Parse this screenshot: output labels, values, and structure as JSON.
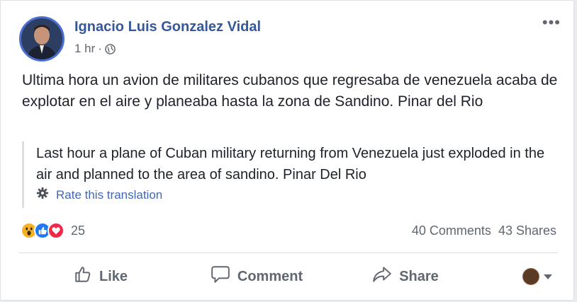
{
  "post": {
    "author": "Ignacio Luis Gonzalez Vidal",
    "time": "1 hr",
    "separator": "·",
    "privacy_icon": "globe-icon",
    "more_icon": "•••",
    "text": "Ultima hora un avion de militares cubanos que regresaba de venezuela acaba de explotar en el aire y planeaba hasta la zona de Sandino. Pinar del Rio",
    "translation": {
      "text": "Last hour a plane of Cuban military returning from Venezuela just exploded in the air and planned to the area of sandino. Pinar Del Rio",
      "rate_label": "Rate this translation"
    }
  },
  "reactions": {
    "icons": [
      "wow-icon",
      "like-icon",
      "love-icon"
    ],
    "count": "25"
  },
  "stats": {
    "comments": "40 Comments",
    "shares": "43 Shares"
  },
  "actions": {
    "like": "Like",
    "comment": "Comment",
    "share": "Share"
  },
  "colors": {
    "link": "#365899",
    "accent": "#4267b2",
    "like_blue": "#2078f4",
    "love_red": "#f0284a",
    "wow_yellow": "#f7b125"
  }
}
